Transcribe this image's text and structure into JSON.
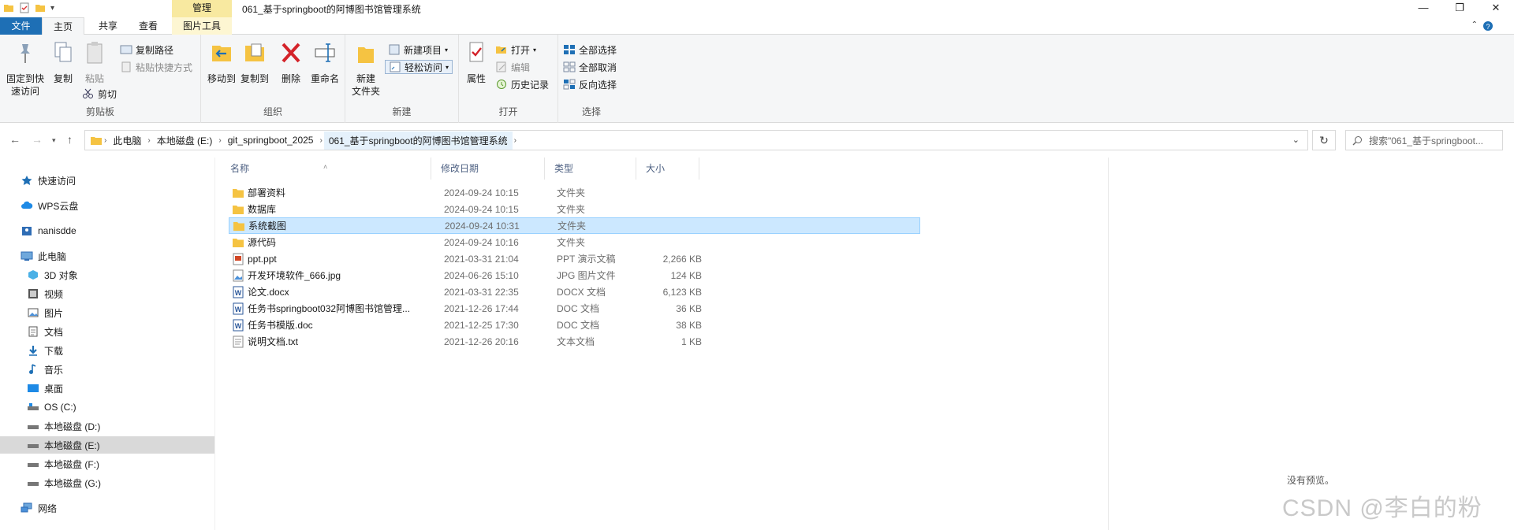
{
  "window": {
    "title": "061_基于springboot的阿博图书馆管理系统",
    "context_tab_group": "管理",
    "controls": {
      "minimize": "—",
      "maximize": "❐",
      "close": "✕"
    }
  },
  "ribbon_tabs": {
    "file": "文件",
    "home": "主页",
    "share": "共享",
    "view": "查看",
    "picture_tools": "图片工具"
  },
  "ribbon": {
    "clipboard": {
      "label": "剪贴板",
      "pin_line1": "固定到快",
      "pin_line2": "速访问",
      "copy": "复制",
      "paste": "粘贴",
      "copy_path": "复制路径",
      "paste_shortcut": "粘贴快捷方式",
      "cut": "剪切"
    },
    "organize": {
      "label": "组织",
      "move_to": "移动到",
      "copy_to": "复制到",
      "delete": "删除",
      "rename": "重命名"
    },
    "new": {
      "label": "新建",
      "new_folder_line1": "新建",
      "new_folder_line2": "文件夹",
      "new_item": "新建项目",
      "easy_access": "轻松访问"
    },
    "open": {
      "label": "打开",
      "properties": "属性",
      "open": "打开",
      "edit": "编辑",
      "history": "历史记录"
    },
    "select": {
      "label": "选择",
      "select_all": "全部选择",
      "select_none": "全部取消",
      "invert": "反向选择"
    }
  },
  "address": {
    "crumbs": [
      "此电脑",
      "本地磁盘 (E:)",
      "git_springboot_2025",
      "061_基于springboot的阿博图书馆管理系统"
    ],
    "search_placeholder": "搜索\"061_基于springboot..."
  },
  "nav_pane": {
    "items": [
      {
        "label": "快速访问",
        "icon": "star-icon"
      },
      {
        "label": "WPS云盘",
        "icon": "cloud-icon"
      },
      {
        "label": "nanisdde",
        "icon": "user-folder-icon"
      },
      {
        "label": "此电脑",
        "icon": "computer-icon"
      },
      {
        "label": "3D 对象",
        "icon": "cube-icon"
      },
      {
        "label": "视频",
        "icon": "video-icon"
      },
      {
        "label": "图片",
        "icon": "picture-icon"
      },
      {
        "label": "文档",
        "icon": "document-icon"
      },
      {
        "label": "下载",
        "icon": "download-icon"
      },
      {
        "label": "音乐",
        "icon": "music-icon"
      },
      {
        "label": "桌面",
        "icon": "desktop-icon"
      },
      {
        "label": "OS (C:)",
        "icon": "drive-icon"
      },
      {
        "label": "本地磁盘 (D:)",
        "icon": "drive-icon"
      },
      {
        "label": "本地磁盘 (E:)",
        "icon": "drive-icon"
      },
      {
        "label": "本地磁盘 (F:)",
        "icon": "drive-icon"
      },
      {
        "label": "本地磁盘 (G:)",
        "icon": "drive-icon"
      },
      {
        "label": "网络",
        "icon": "network-icon"
      }
    ]
  },
  "columns": {
    "name": "名称",
    "date": "修改日期",
    "type": "类型",
    "size": "大小"
  },
  "files": [
    {
      "name": "部署资料",
      "date": "2024-09-24 10:15",
      "type": "文件夹",
      "size": "",
      "icon": "folder-icon"
    },
    {
      "name": "数据库",
      "date": "2024-09-24 10:15",
      "type": "文件夹",
      "size": "",
      "icon": "folder-icon"
    },
    {
      "name": "系统截图",
      "date": "2024-09-24 10:31",
      "type": "文件夹",
      "size": "",
      "icon": "folder-icon"
    },
    {
      "name": "源代码",
      "date": "2024-09-24 10:16",
      "type": "文件夹",
      "size": "",
      "icon": "folder-icon"
    },
    {
      "name": "ppt.ppt",
      "date": "2021-03-31 21:04",
      "type": "PPT 演示文稿",
      "size": "2,266 KB",
      "icon": "ppt-file-icon"
    },
    {
      "name": "开发环境软件_666.jpg",
      "date": "2024-06-26 15:10",
      "type": "JPG 图片文件",
      "size": "124 KB",
      "icon": "image-file-icon"
    },
    {
      "name": "论文.docx",
      "date": "2021-03-31 22:35",
      "type": "DOCX 文档",
      "size": "6,123 KB",
      "icon": "word-file-icon"
    },
    {
      "name": "任务书springboot032阿博图书馆管理...",
      "date": "2021-12-26 17:44",
      "type": "DOC 文档",
      "size": "36 KB",
      "icon": "word-file-icon"
    },
    {
      "name": "任务书模版.doc",
      "date": "2021-12-25 17:30",
      "type": "DOC 文档",
      "size": "38 KB",
      "icon": "word-file-icon"
    },
    {
      "name": "说明文档.txt",
      "date": "2021-12-26 20:16",
      "type": "文本文档",
      "size": "1 KB",
      "icon": "text-file-icon"
    }
  ],
  "preview": {
    "empty_text": "没有预览。"
  },
  "watermark": "CSDN @李白的粉",
  "colors": {
    "file_tab": "#1e6fb5",
    "selection": "#cce8ff",
    "manage_tab": "#f8e9a0",
    "folder": "#f5c342"
  }
}
